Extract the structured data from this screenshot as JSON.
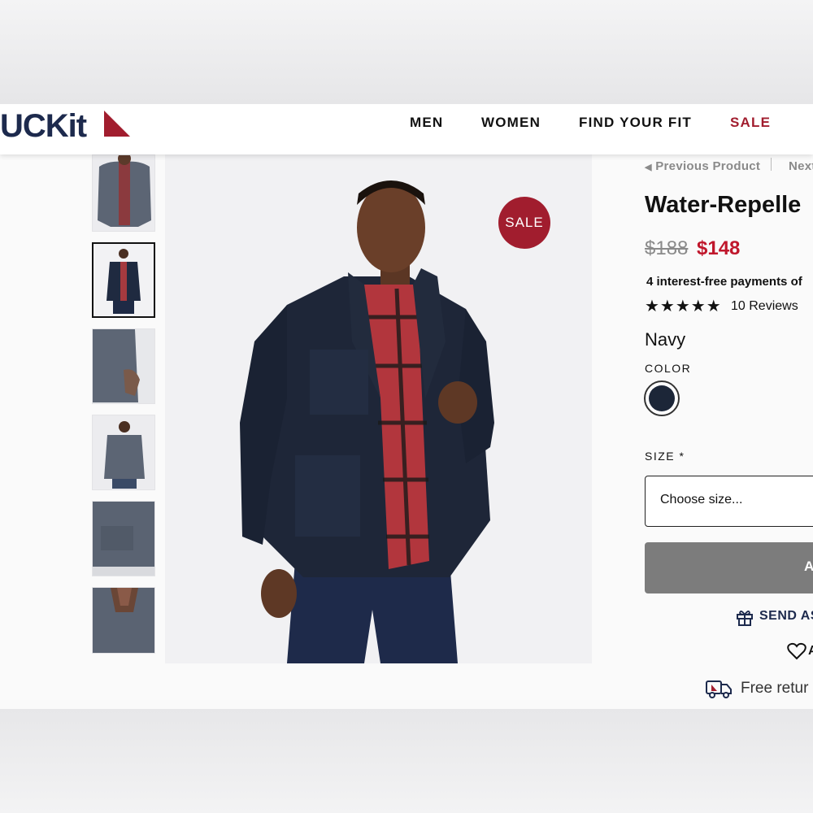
{
  "header": {
    "logo_text": "UCKit",
    "nav": [
      {
        "label": "MEN"
      },
      {
        "label": "WOMEN"
      },
      {
        "label": "FIND YOUR FIT"
      },
      {
        "label": "SALE"
      }
    ]
  },
  "gallery": {
    "badge": "SALE",
    "thumbnail_count": 6,
    "active_thumbnail": 2
  },
  "product": {
    "pager_prev": "Previous Product",
    "pager_next": "Next",
    "title": "Water-Repelle",
    "old_price": "$188",
    "new_price": "$148",
    "installments": "4 interest-free payments of",
    "rating_stars": "★★★★★",
    "reviews": "10 Reviews",
    "color_name": "Navy",
    "color_label": "COLOR",
    "swatch_color": "#1c2638",
    "size_label": "SIZE *",
    "size_placeholder": "Choose size...",
    "add_button": "A",
    "send_gift": "SEND AS",
    "wishlist": "A",
    "returns": "Free retur"
  },
  "colors": {
    "brand_navy": "#1d2a4d",
    "sale_red": "#a11d2e",
    "price_red": "#c0172c"
  }
}
